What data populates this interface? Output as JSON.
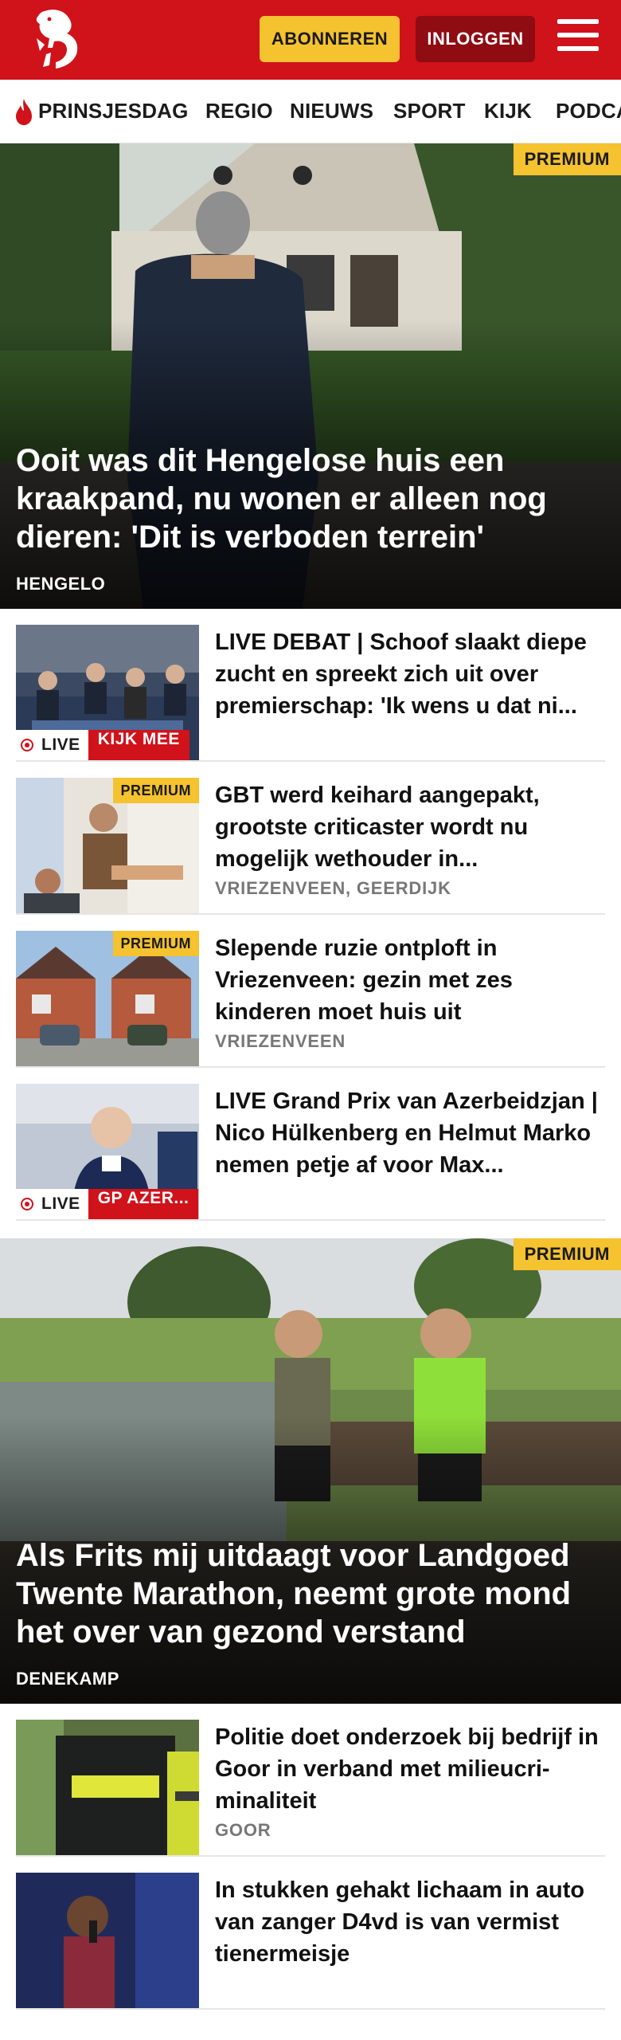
{
  "header": {
    "subscribe_label": "ABONNEREN",
    "login_label": "INLOGGEN",
    "brand_color": "#d0121b",
    "accent_color": "#f5c230"
  },
  "nav": {
    "items": [
      "PRINSJESDAG",
      "REGIO",
      "NIEUWS",
      "SPORT",
      "KIJK",
      "PODCA"
    ]
  },
  "hero1": {
    "badge": "PREMIUM",
    "title": "Ooit was dit Hengelose huis een kraakpand, nu wonen er alleen nog dieren: 'Dit is verboden terrein'",
    "location": "HENGELO"
  },
  "list1": [
    {
      "title": "LIVE DEBAT | Schoof slaakt diepe zucht en spreekt zich uit over premierschap: 'Ik wens u dat ni...",
      "live_label": "LIVE",
      "cta": "KIJK MEE"
    },
    {
      "title": "GBT werd keihard aangepakt, grootste criticaster wordt nu mogelijk wethouder in...",
      "location": "VRIEZENVEEN, GEERDIJK",
      "badge": "PREMIUM"
    },
    {
      "title": "Slepende ruzie ontploft in Vriezenveen: gezin met zes kinderen moet huis uit",
      "location": "VRIEZENVEEN",
      "badge": "PREMIUM"
    },
    {
      "title": "LIVE Grand Prix van Azerbeidzjan | Nico Hülkenberg en Helmut Marko nemen petje af voor Max...",
      "live_label": "LIVE",
      "cta": "GP AZER..."
    }
  ],
  "hero2": {
    "badge": "PREMIUM",
    "title": "Als Frits mij uitdaagt voor Landgoed Twente Marathon, neemt grote mond het over van gezond verstand",
    "location": "DENEKAMP"
  },
  "list2": [
    {
      "title": "Politie doet onderzoek bij bedrijf in Goor in verband met milieucri-minaliteit",
      "location": "GOOR"
    },
    {
      "title": "In stukken gehakt lichaam in auto van zanger D4vd is van vermist tienermeisje"
    }
  ]
}
